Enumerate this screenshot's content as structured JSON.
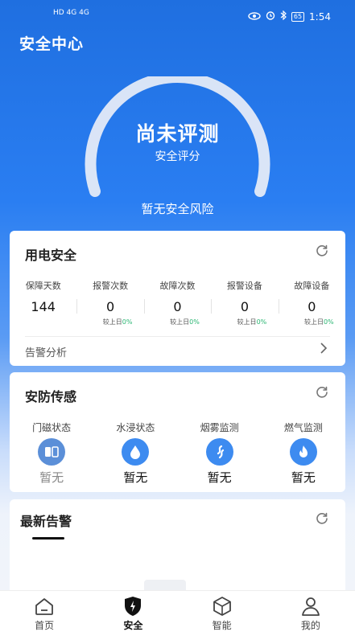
{
  "status_bar": {
    "left": "HD 4G 4G",
    "battery": "65",
    "time": "1:54"
  },
  "header": {
    "title": "安全中心"
  },
  "score": {
    "status": "尚未评测",
    "label": "安全评分",
    "risk": "暂无安全风险"
  },
  "electric": {
    "title": "用电安全",
    "stats": [
      {
        "label": "保障天数",
        "value": "144",
        "sub_prefix": "",
        "sub_pct": ""
      },
      {
        "label": "报警次数",
        "value": "0",
        "sub_prefix": "较上日",
        "sub_pct": "0%"
      },
      {
        "label": "故障次数",
        "value": "0",
        "sub_prefix": "较上日",
        "sub_pct": "0%"
      },
      {
        "label": "报警设备",
        "value": "0",
        "sub_prefix": "较上日",
        "sub_pct": "0%"
      },
      {
        "label": "故障设备",
        "value": "0",
        "sub_prefix": "较上日",
        "sub_pct": "0%"
      }
    ],
    "analysis": "告警分析"
  },
  "security": {
    "title": "安防传感",
    "sensors": [
      {
        "label": "门磁状态",
        "value": "暂无",
        "icon": "door-sensor-icon",
        "color": "#5b8fd8",
        "value_color": "#888888"
      },
      {
        "label": "水浸状态",
        "value": "暂无",
        "icon": "water-drop-icon",
        "color": "#3d8bf0",
        "value_color": "#111111"
      },
      {
        "label": "烟雾监测",
        "value": "暂无",
        "icon": "smoke-icon",
        "color": "#3d8bf0",
        "value_color": "#111111"
      },
      {
        "label": "燃气监测",
        "value": "暂无",
        "icon": "flame-icon",
        "color": "#3d8bf0",
        "value_color": "#111111"
      }
    ]
  },
  "alerts": {
    "title": "最新告警"
  },
  "tabbar": [
    {
      "label": "首页",
      "icon": "home-icon"
    },
    {
      "label": "安全",
      "icon": "shield-bolt-icon",
      "active": true
    },
    {
      "label": "智能",
      "icon": "cube-icon"
    },
    {
      "label": "我的",
      "icon": "person-icon"
    }
  ],
  "colors": {
    "primary": "#2a7ef2",
    "accent_green": "#2bb673"
  }
}
